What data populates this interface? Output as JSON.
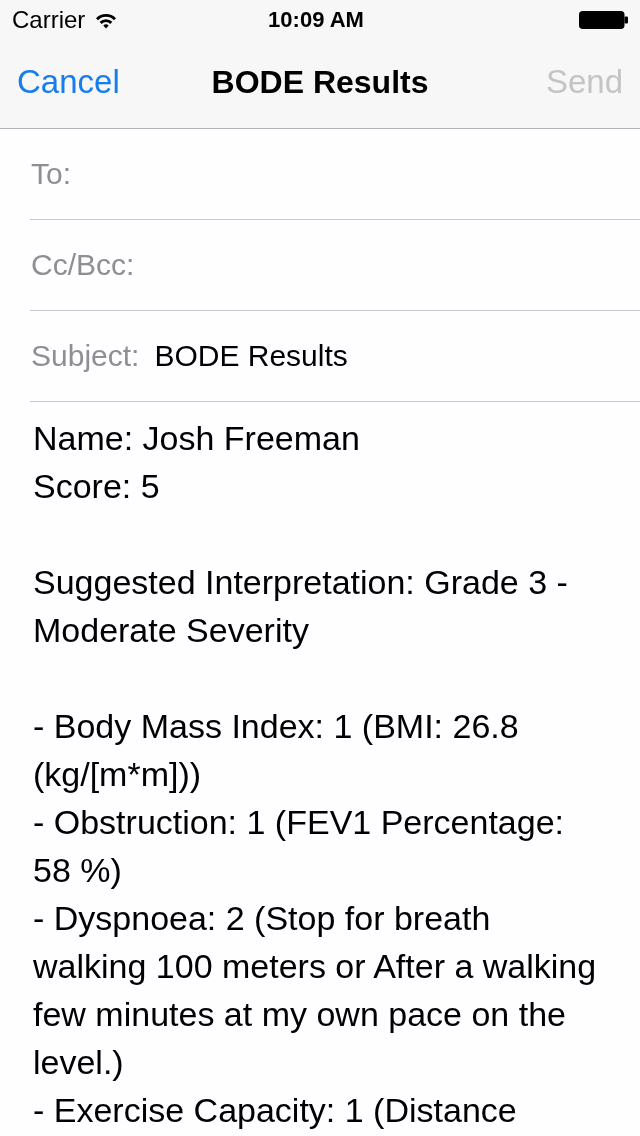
{
  "status_bar": {
    "carrier": "Carrier",
    "time": "10:09 AM"
  },
  "nav_bar": {
    "cancel": "Cancel",
    "title": "BODE Results",
    "send": {
      "label": "Send",
      "disabled": true
    }
  },
  "fields": [
    {
      "label": "To:"
    },
    {
      "label": "Cc/Bcc:"
    },
    {
      "label": "Subject:",
      "value": "BODE Results"
    }
  ],
  "body": [
    {
      "lines": [
        "Name: Josh Freeman",
        "Score: 5"
      ]
    },
    {
      "lines": [
        "Suggested Interpretation: Grade 3 - Moderate Severity"
      ]
    },
    {
      "lines": [
        "- Body Mass Index: 1 (BMI: 26.8 (kg/[m*m]))",
        "- Obstruction: 1 (FEV1 Percentage: 58 %)",
        "- Dyspnoea: 2 (Stop for breath walking 100 meters or After a walking few minutes at my own pace on the level.)",
        "- Exercise Capacity: 1 (Distance"
      ]
    }
  ]
}
